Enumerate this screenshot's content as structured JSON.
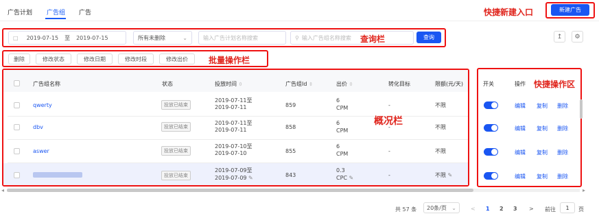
{
  "tabs": [
    {
      "label": "广告计划"
    },
    {
      "label": "广告组"
    },
    {
      "label": "广告"
    }
  ],
  "annotations": {
    "new_entry": "快捷新建入口",
    "query_bar": "查询栏",
    "batch_bar": "批量操作栏",
    "overview": "概况栏",
    "quick_ops": "快捷操作区"
  },
  "new_button_label": "新建广告",
  "query": {
    "date_start": "2019-07-15",
    "date_sep": "至",
    "date_end": "2019-07-15",
    "status_select": "所有未删除",
    "plan_search_placeholder": "输入广告计划名称搜索",
    "group_search_placeholder": "输入广告组名称搜索",
    "query_button": "查询"
  },
  "batch_actions": [
    "删除",
    "修改状态",
    "修改日期",
    "修改时段",
    "修改出价"
  ],
  "table": {
    "headers": {
      "name": "广告组名称",
      "status": "状态",
      "time": "投放时间",
      "id": "广告组Id",
      "bid": "出价",
      "target": "转化目标",
      "limit": "限额(元/天)",
      "switch": "开关",
      "ops": "操作"
    },
    "rows": [
      {
        "name": "qwerty",
        "status": "投放已结束",
        "time1": "2019-07-11至",
        "time2": "2019-07-11",
        "id": "859",
        "bid1": "6",
        "bid2": "CPM",
        "target": "-",
        "limit": "不限",
        "on": true
      },
      {
        "name": "dbv",
        "status": "投放已结束",
        "time1": "2019-07-11至",
        "time2": "2019-07-11",
        "id": "858",
        "bid1": "6",
        "bid2": "CPM",
        "target": "-",
        "limit": "不限",
        "on": true
      },
      {
        "name": "aswer",
        "status": "投放已结束",
        "time1": "2019-07-10至",
        "time2": "2019-07-10",
        "id": "855",
        "bid1": "6",
        "bid2": "CPM",
        "target": "-",
        "limit": "不限",
        "on": true
      },
      {
        "name": "",
        "status": "投放已结束",
        "time1": "2019-07-09至",
        "time2": "2019-07-09",
        "id": "843",
        "bid1": "0.3",
        "bid2": "CPC",
        "target": "-",
        "limit": "不限",
        "on": true
      }
    ],
    "ops": [
      "编辑",
      "复制",
      "删除"
    ]
  },
  "pagination": {
    "total": "共 57 条",
    "page_size": "20条/页",
    "pages": [
      "1",
      "2",
      "3"
    ],
    "goto_label": "前往",
    "goto_value": "1",
    "page_unit": "页"
  },
  "colors": {
    "accent": "#1a56f2",
    "annotation": "#e0251d"
  }
}
